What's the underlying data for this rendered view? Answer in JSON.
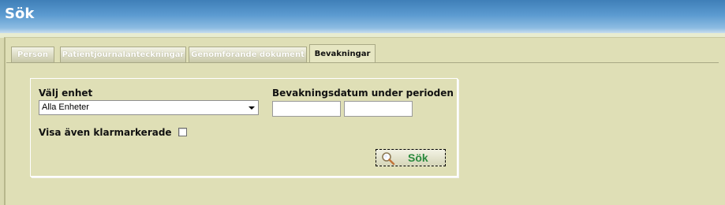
{
  "window": {
    "title": "Sök"
  },
  "tabs": [
    {
      "label": "Person"
    },
    {
      "label": "Patientjournalanteckningar"
    },
    {
      "label": "Genomförande dokument"
    },
    {
      "label": "Bevakningar",
      "active": true
    }
  ],
  "form": {
    "unit_label": "Välj enhet",
    "unit_selected": "Alla Enheter",
    "period_label": "Bevakningsdatum under perioden",
    "date_from": "",
    "date_to": "",
    "show_done_label": "Visa även klarmarkerade",
    "show_done_checked": false,
    "search_label": "Sök",
    "search_icon": "magnifier-icon"
  },
  "colors": {
    "title_bar": "#5b9ad0",
    "panel_bg": "#dfdfb6",
    "search_text": "#2b8a3e"
  }
}
